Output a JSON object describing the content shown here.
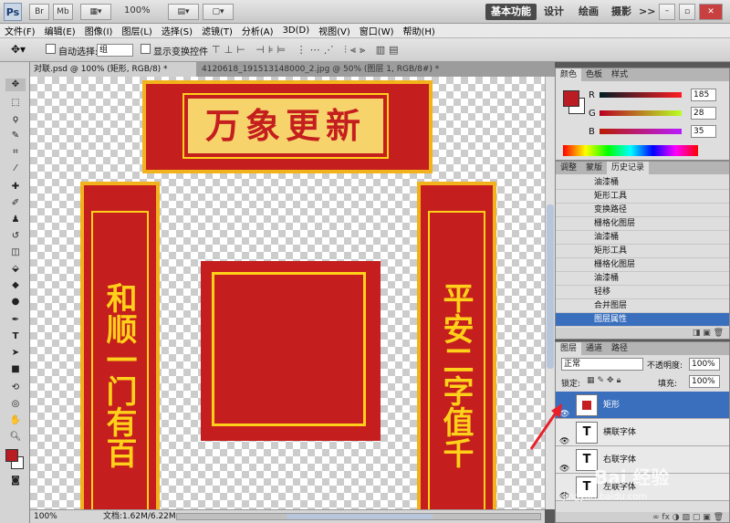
{
  "app": {
    "logo": "Ps",
    "bar_buttons": [
      "Br",
      "Mb"
    ],
    "zoom": "100%",
    "workspaces": [
      "基本功能",
      "设计",
      "绘画",
      "摄影"
    ],
    "more": ">>"
  },
  "menu": [
    "文件(F)",
    "编辑(E)",
    "图像(I)",
    "图层(L)",
    "选择(S)",
    "滤镜(T)",
    "分析(A)",
    "3D(D)",
    "视图(V)",
    "窗口(W)",
    "帮助(H)"
  ],
  "options": {
    "auto_select_label": "自动选择:",
    "auto_select_value": "组",
    "show_transform_label": "显示变换控件"
  },
  "tabs": [
    {
      "label": "对联.psd @ 100% (矩形, RGB/8) *",
      "active": true
    },
    {
      "label": "4120618_191513148000_2.jpg @ 50% (图层 1, RGB/8#) *",
      "active": false
    }
  ],
  "canvas": {
    "header_text": "万象更新",
    "left_couplet": "和顺一门有百",
    "right_couplet": "平安二字值千"
  },
  "status": {
    "zoom": "100%",
    "doc_info": "文档:1.62M/6.22M"
  },
  "color_panel": {
    "tabs": [
      "颜色",
      "色板",
      "样式"
    ],
    "r_label": "R",
    "g_label": "G",
    "b_label": "B",
    "r": 185,
    "g": 28,
    "b": 35,
    "fg_color": "#b91c23"
  },
  "history_panel": {
    "tabs": [
      "调整",
      "蒙版",
      "历史记录"
    ],
    "items": [
      "油漆桶",
      "矩形工具",
      "变换路径",
      "栅格化图层",
      "油漆桶",
      "矩形工具",
      "栅格化图层",
      "油漆桶",
      "轻移",
      "合并图层",
      "图层属性"
    ]
  },
  "layers_panel": {
    "tabs": [
      "图层",
      "通道",
      "路径"
    ],
    "blend_mode": "正常",
    "opacity_label": "不透明度:",
    "opacity": "100%",
    "lock_label": "锁定:",
    "fill_label": "填充:",
    "fill": "100%",
    "layers": [
      {
        "name": "矩形",
        "selected": true,
        "thumb": ""
      },
      {
        "name": "横联字体",
        "selected": false,
        "thumb": "T"
      },
      {
        "name": "右联字体",
        "selected": false,
        "thumb": "T"
      },
      {
        "name": "左联字体",
        "selected": false,
        "thumb": "T"
      }
    ]
  },
  "watermark": "Bai 经验",
  "watermark_url": "jingyan.baidu.com"
}
